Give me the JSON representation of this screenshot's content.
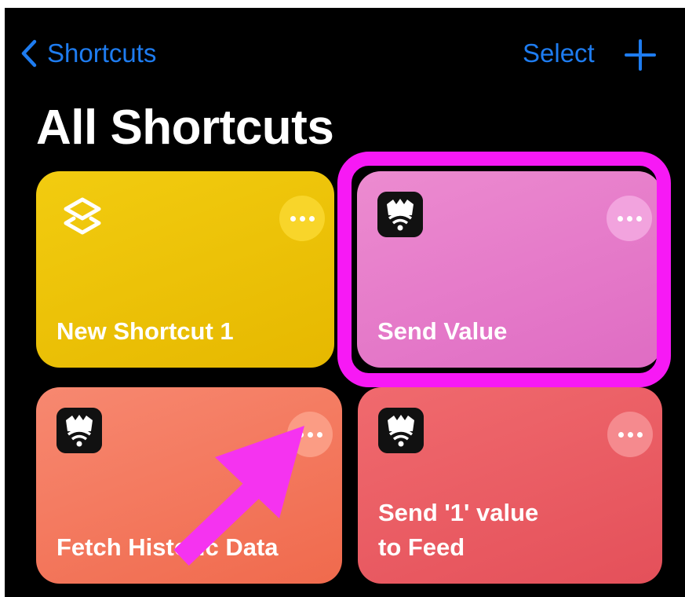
{
  "nav": {
    "back_label": "Shortcuts",
    "select_label": "Select"
  },
  "page": {
    "title": "All Shortcuts"
  },
  "shortcuts": [
    {
      "label": "New Shortcut 1",
      "color": "#e9bd0a",
      "icon": "layers-icon"
    },
    {
      "label": "Send Value",
      "color": "#e57cc9",
      "icon": "app-logo-icon"
    },
    {
      "label": "Fetch Historic Data",
      "color": "#f47a5e",
      "icon": "app-logo-icon"
    },
    {
      "label_line1": "Send '1' value",
      "label_line2": "to Feed",
      "color": "#ea5d63",
      "icon": "app-logo-icon"
    }
  ],
  "annotations": {
    "highlight_color": "#f719f5",
    "arrow_color": "#f533f0"
  },
  "colors": {
    "accent": "#1e7cf0",
    "background": "#000000"
  }
}
